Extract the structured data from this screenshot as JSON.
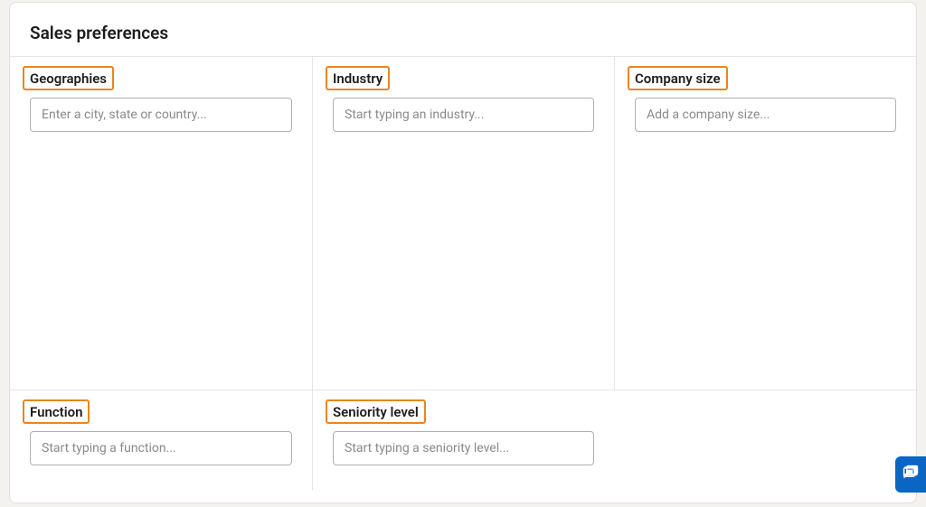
{
  "title": "Sales preferences",
  "fields": {
    "geographies": {
      "label": "Geographies",
      "placeholder": "Enter a city, state or country..."
    },
    "industry": {
      "label": "Industry",
      "placeholder": "Start typing an industry..."
    },
    "company_size": {
      "label": "Company size",
      "placeholder": "Add a company size..."
    },
    "function": {
      "label": "Function",
      "placeholder": "Start typing a function..."
    },
    "seniority": {
      "label": "Seniority level",
      "placeholder": "Start typing a seniority level..."
    }
  },
  "highlight_color": "#e8871e",
  "accent_color": "#0a66c2"
}
